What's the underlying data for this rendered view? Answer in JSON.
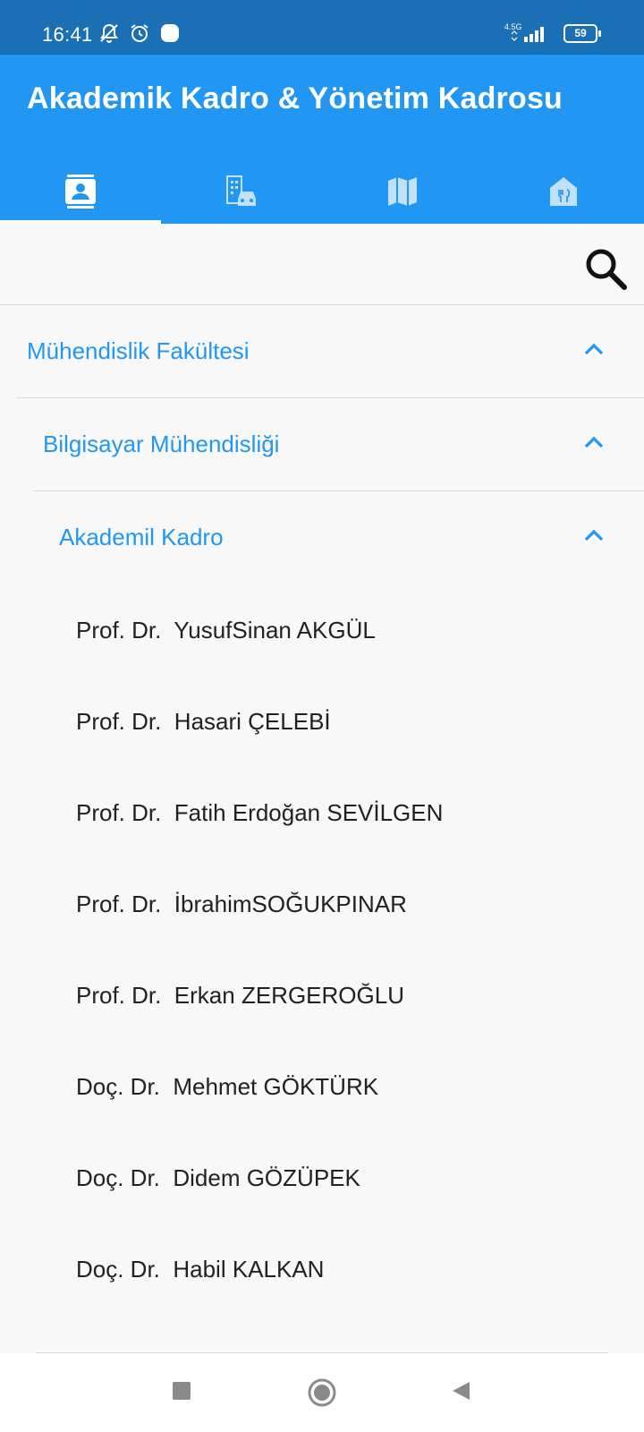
{
  "status_bar": {
    "time": "16:41",
    "network": "4.5G",
    "battery": "59",
    "icons": [
      "bell-off-icon",
      "alarm-icon",
      "notification-dot-icon",
      "signal-icon",
      "battery-icon"
    ]
  },
  "app_bar": {
    "title": "Akademik Kadro & Yönetim Kadrosu",
    "background": "#2196f3",
    "tabs": [
      {
        "icon": "contacts-icon",
        "active": true
      },
      {
        "icon": "building-car-icon",
        "active": false
      },
      {
        "icon": "map-icon",
        "active": false
      },
      {
        "icon": "restaurant-icon",
        "active": false
      }
    ]
  },
  "search": {
    "icon": "search-icon"
  },
  "tree": {
    "level1": {
      "label": "Mühendislik Fakültesi",
      "expanded": true
    },
    "level2": {
      "label": "Bilgisayar Mühendisliği",
      "expanded": true
    },
    "level3": {
      "label": "Akademil Kadro",
      "expanded": true
    },
    "staff": [
      "Prof. Dr.  YusufSinan AKGÜL",
      "Prof. Dr.  Hasari ÇELEBİ",
      "Prof. Dr.  Fatih Erdoğan SEVİLGEN",
      "Prof. Dr.  İbrahimSOĞUKPINAR",
      "Prof. Dr.  Erkan ZERGEROĞLU",
      "Doç. Dr.  Mehmet GÖKTÜRK",
      "Doç. Dr.  Didem GÖZÜPEK",
      "Doç. Dr.  Habil KALKAN"
    ]
  },
  "accent_color": "#2196f3",
  "nav_bar": {
    "buttons": [
      "recents-button",
      "home-button",
      "back-button"
    ]
  }
}
